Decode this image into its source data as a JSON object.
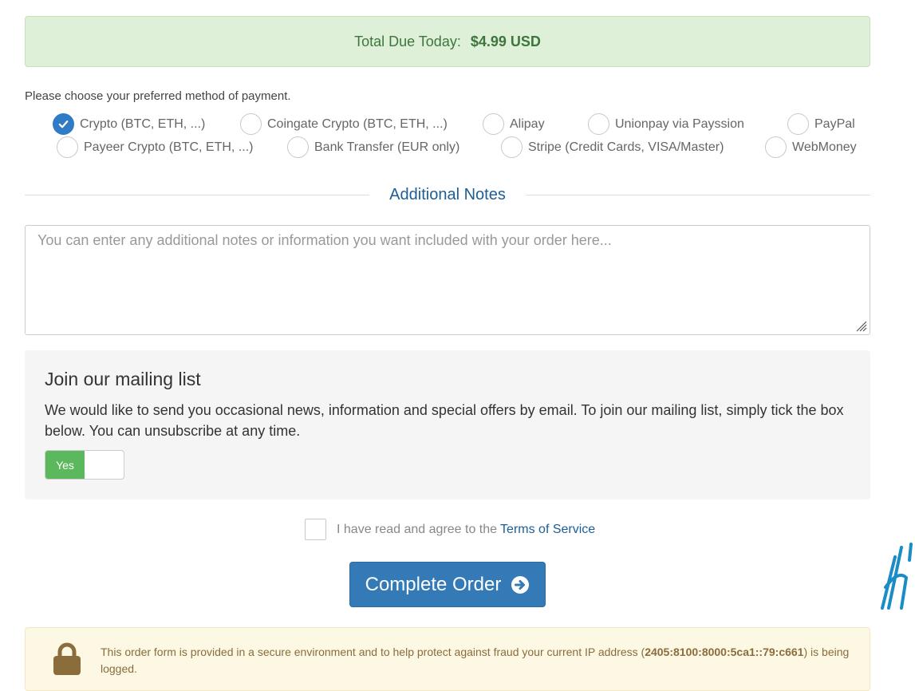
{
  "total_due": {
    "label": "Total Due Today:",
    "amount": "$4.99 USD"
  },
  "payment": {
    "prompt": "Please choose your preferred method of payment.",
    "selected": "Crypto (BTC, ETH, ...)",
    "options": [
      "Crypto (BTC, ETH, ...)",
      "Coingate Crypto (BTC, ETH, ...)",
      "Alipay",
      "Unionpay via Payssion",
      "PayPal",
      "Payeer Crypto (BTC, ETH, ...)",
      "Bank Transfer (EUR only)",
      "Stripe (Credit Cards, VISA/Master)",
      "WebMoney"
    ]
  },
  "notes": {
    "heading": "Additional Notes",
    "placeholder": "You can enter any additional notes or information you want included with your order here...",
    "value": ""
  },
  "mailing": {
    "title": "Join our mailing list",
    "text": "We would like to send you occasional news, information and special offers by email. To join our mailing list, simply tick the box below. You can unsubscribe at any time.",
    "toggle_label": "Yes",
    "toggle_on": true
  },
  "tos": {
    "text": "I have read and agree to the",
    "link": "Terms of Service",
    "checked": false
  },
  "complete_button": {
    "label": "Complete Order"
  },
  "secure": {
    "text_before": "This order form is provided in a secure environment and to help protect against fraud your current IP address (",
    "ip": "2405:8100:8000:5ca1::79:c661",
    "text_after": ") is being logged."
  },
  "colors": {
    "success_bg": "#dff0d8",
    "success_text": "#3c763d",
    "primary": "#337ab7",
    "toggle_on": "#5cb85c",
    "warning_bg": "#fcf8e3",
    "warning_text": "#8a6d3b",
    "heading_blue": "#1d5e95"
  }
}
